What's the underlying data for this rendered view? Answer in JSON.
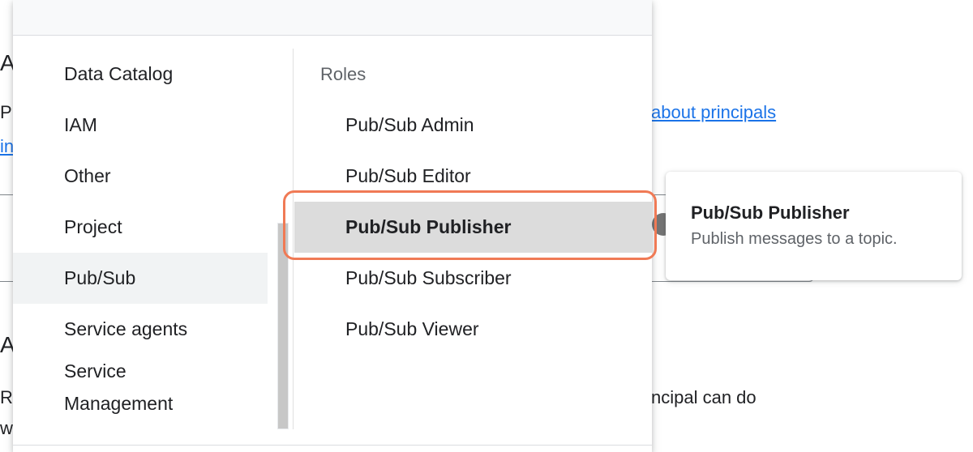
{
  "background": {
    "heading_1_fragment": "A",
    "text_1_fragment": "Pr",
    "link_1_fragment": "in",
    "link_principals": "about principals",
    "heading_2_fragment": "A",
    "text_2_fragment": "Ro",
    "text_3_fragment": "w",
    "text_principal_can_do": "ncipal can do"
  },
  "dropdown": {
    "services": [
      {
        "label": "Data Catalog",
        "selected": false
      },
      {
        "label": "IAM",
        "selected": false
      },
      {
        "label": "Other",
        "selected": false
      },
      {
        "label": "Project",
        "selected": false
      },
      {
        "label": "Pub/Sub",
        "selected": true
      },
      {
        "label": "Service agents",
        "selected": false
      },
      {
        "label": "Service Management",
        "selected": false
      }
    ],
    "roles_header": "Roles",
    "roles": [
      {
        "label": "Pub/Sub Admin",
        "highlighted": false
      },
      {
        "label": "Pub/Sub Editor",
        "highlighted": false
      },
      {
        "label": "Pub/Sub Publisher",
        "highlighted": true
      },
      {
        "label": "Pub/Sub Subscriber",
        "highlighted": false
      },
      {
        "label": "Pub/Sub Viewer",
        "highlighted": false
      }
    ]
  },
  "tooltip": {
    "title": "Pub/Sub Publisher",
    "description": "Publish messages to a topic."
  },
  "colors": {
    "link": "#1a73e8",
    "annotation": "#f07a55",
    "highlight": "#dcdcdc",
    "selected_service": "#f1f3f4"
  }
}
